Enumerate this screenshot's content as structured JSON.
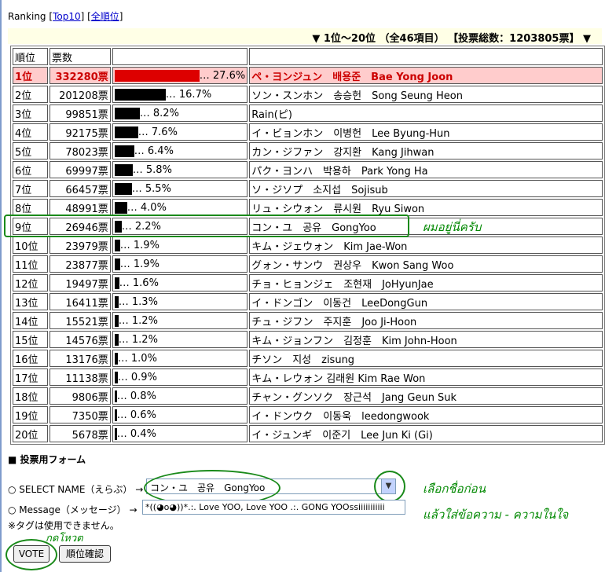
{
  "header": {
    "ranking_label": "Ranking",
    "open_bracket": "[",
    "top10_link": "Top10",
    "separator": "] [",
    "all_link": "全順位",
    "close_bracket": "]"
  },
  "range_line": "▼ 1位～20位 （全46項目） 【投票総数：1203805票】 ▼",
  "table": {
    "headers": [
      "順位",
      "票数",
      "",
      ""
    ],
    "rows": [
      {
        "rank": "1位",
        "votes": "332280票",
        "percent": "27.6%",
        "name": "ペ・ヨンジュン　배용준　Bae Yong Joon"
      },
      {
        "rank": "2位",
        "votes": "201208票",
        "percent": "16.7%",
        "name": "ソン・スンホン　송승헌　Song Seung Heon"
      },
      {
        "rank": "3位",
        "votes": "99851票",
        "percent": "8.2%",
        "name": "Rain(ピ)"
      },
      {
        "rank": "4位",
        "votes": "92175票",
        "percent": "7.6%",
        "name": "イ・ビョンホン　이병헌　Lee Byung-Hun"
      },
      {
        "rank": "5位",
        "votes": "78023票",
        "percent": "6.4%",
        "name": "カン・ジファン　강지환　Kang Jihwan"
      },
      {
        "rank": "6位",
        "votes": "69997票",
        "percent": "5.8%",
        "name": "パク・ヨンハ　박용하　Park Yong Ha"
      },
      {
        "rank": "7位",
        "votes": "66457票",
        "percent": "5.5%",
        "name": "ソ・ジソプ　소지섭　Sojisub"
      },
      {
        "rank": "8位",
        "votes": "48991票",
        "percent": "4.0%",
        "name": "リュ・シウォン　류시원　Ryu Siwon"
      },
      {
        "rank": "9位",
        "votes": "26946票",
        "percent": "2.2%",
        "name": "コン・ユ　공유　GongYoo"
      },
      {
        "rank": "10位",
        "votes": "23979票",
        "percent": "1.9%",
        "name": "キム・ジェウォン　Kim Jae-Won"
      },
      {
        "rank": "11位",
        "votes": "23877票",
        "percent": "1.9%",
        "name": "グォン・サンウ　권상우　Kwon Sang Woo"
      },
      {
        "rank": "12位",
        "votes": "19497票",
        "percent": "1.6%",
        "name": "チョ・ヒョンジェ　조현재　JoHyunJae"
      },
      {
        "rank": "13位",
        "votes": "16411票",
        "percent": "1.3%",
        "name": "イ・ドンゴン　이동건　LeeDongGun"
      },
      {
        "rank": "14位",
        "votes": "15521票",
        "percent": "1.2%",
        "name": "チュ・ジフン　주지훈　Joo Ji-Hoon"
      },
      {
        "rank": "15位",
        "votes": "14576票",
        "percent": "1.2%",
        "name": "キム・ジョンフン　김정훈　Kim John-Hoon"
      },
      {
        "rank": "16位",
        "votes": "13176票",
        "percent": "1.0%",
        "name": "チソン　지성　zisung"
      },
      {
        "rank": "17位",
        "votes": "11138票",
        "percent": "0.9%",
        "name": "キム・レウォン 김래원 Kim Rae Won"
      },
      {
        "rank": "18位",
        "votes": "9806票",
        "percent": "0.8%",
        "name": "チャン・グンソク　장근석　Jang Geun Suk"
      },
      {
        "rank": "19位",
        "votes": "7350票",
        "percent": "0.6%",
        "name": "イ・ドンウク　이동욱　leedongwook"
      },
      {
        "rank": "20位",
        "votes": "5678票",
        "percent": "0.4%",
        "name": "イ・ジュンギ　이준기　Lee Jun Ki (Gi)"
      }
    ]
  },
  "form": {
    "title": "■ 投票用フォーム",
    "select_label": "○ SELECT NAME（えらぶ） →",
    "select_value": "コン・ユ　공유　GongYoo",
    "select_arrow": "▼",
    "message_label": "○ Message（メッセージ） →",
    "message_value": "*((◕o◕))*.:. Love YOO, Love YOO .:. GONG YOOssiiiiiiiiiii",
    "note": "※タグは使用できません。",
    "vote_button": "VOTE",
    "check_button": "順位確認"
  },
  "annotations": {
    "me_here": "ผมอยู่นี่ครับ",
    "choose_name": "เลือกชื่อก่อน",
    "add_message": "แล้วใส่ข้อความ - ความในใจ",
    "press_vote": "กดโหวต"
  },
  "colors": {
    "top_row_bg": "#ffcccc",
    "top_row_text": "#cc0000",
    "top_bar": "#dd0000",
    "bar": "#000000",
    "annotation": "#008800"
  }
}
